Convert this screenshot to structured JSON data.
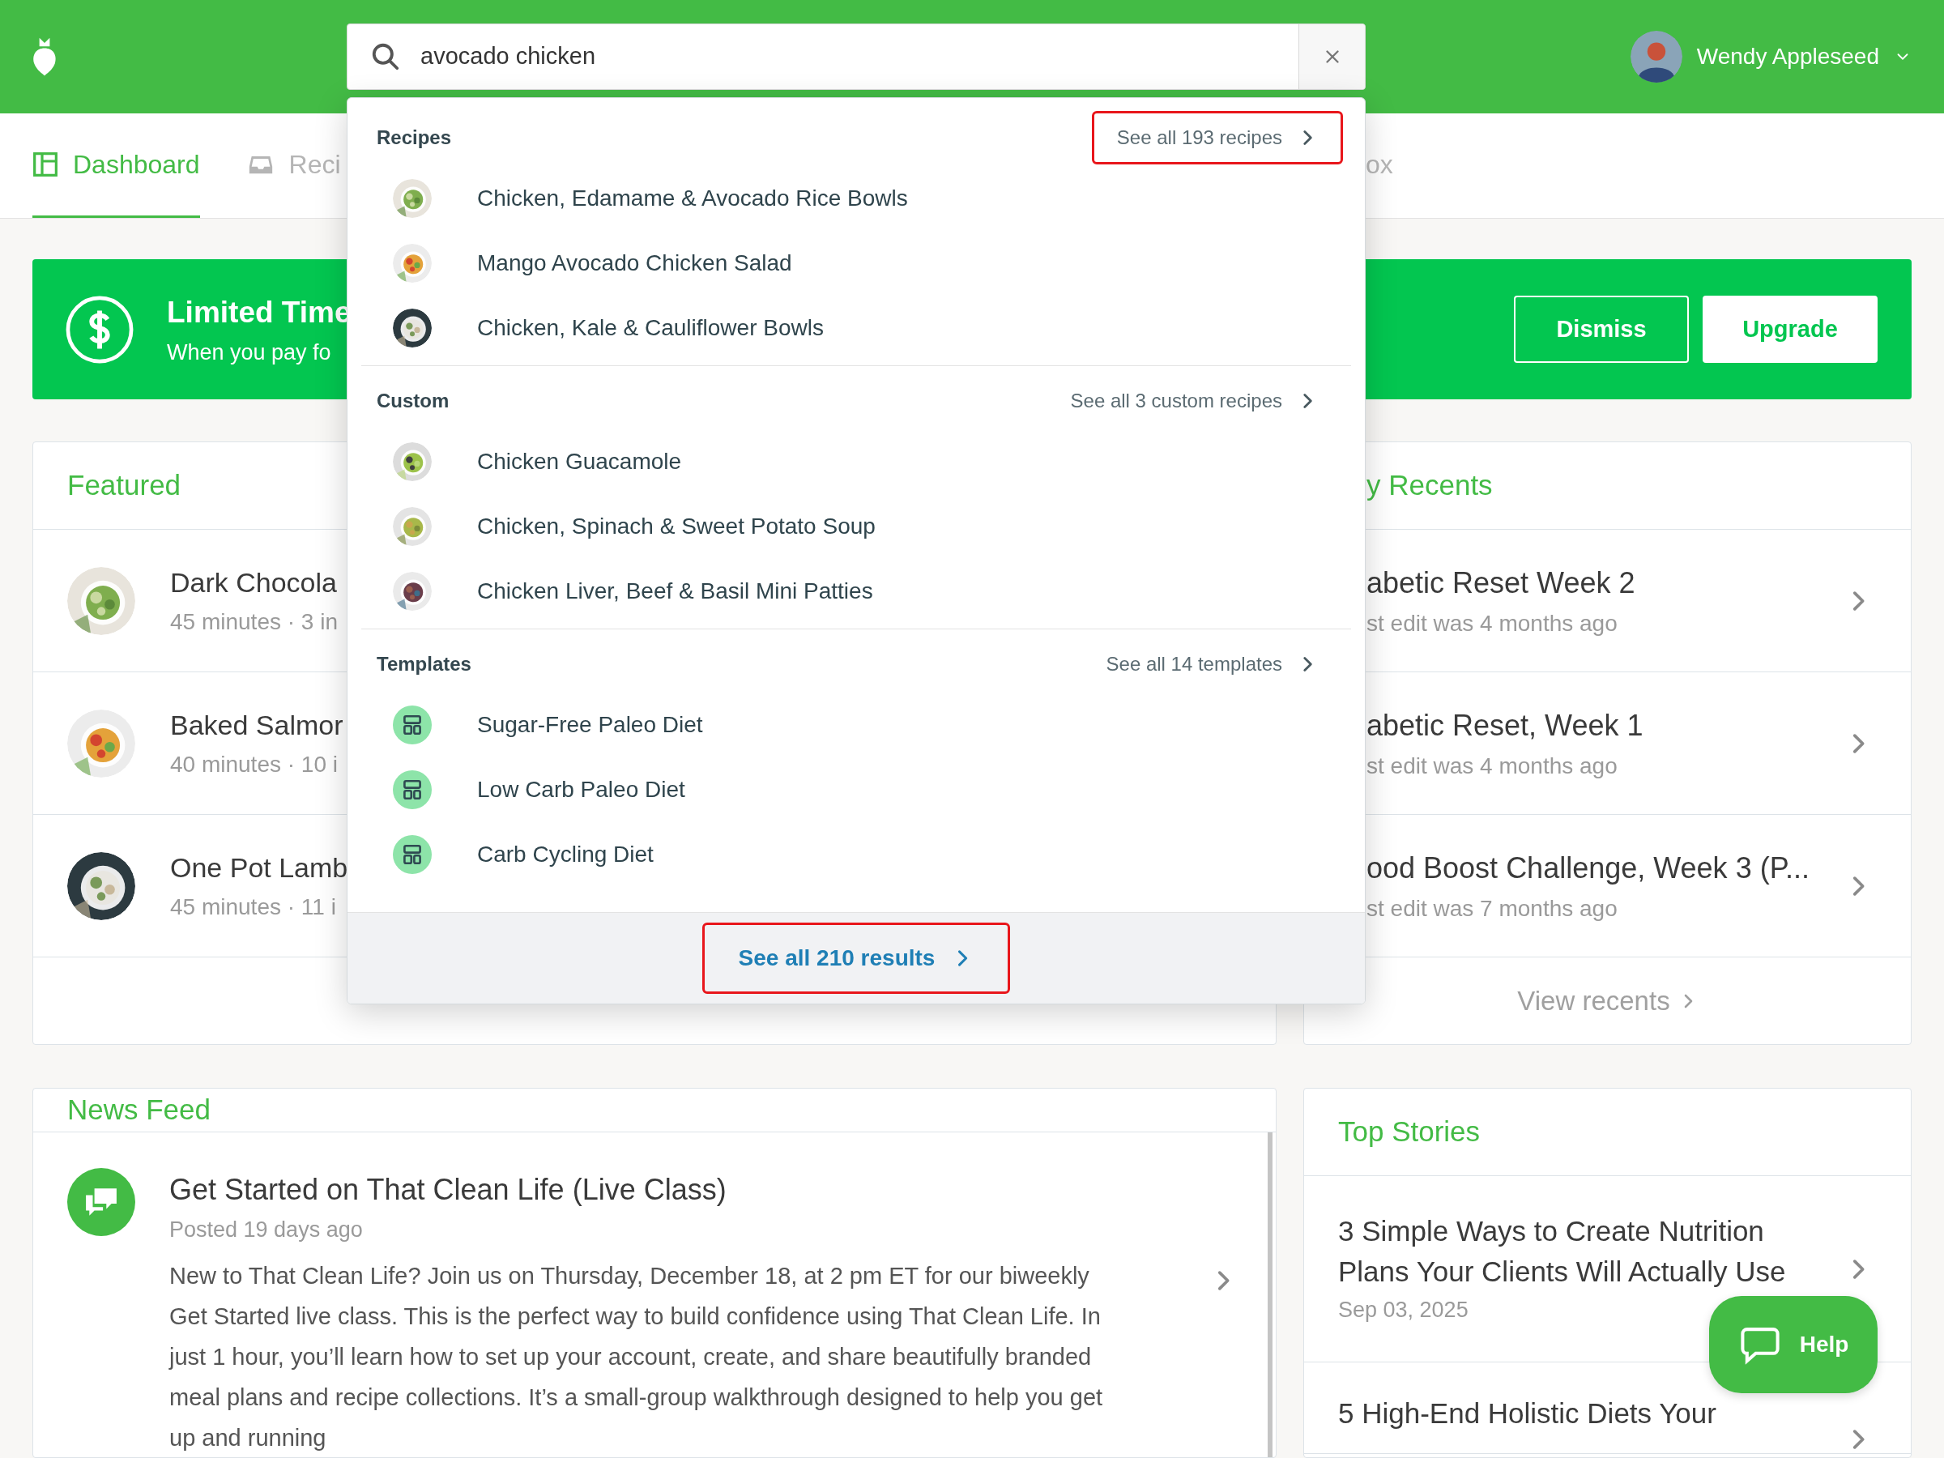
{
  "header": {
    "user_name": "Wendy Appleseed"
  },
  "search": {
    "value": "avocado chicken"
  },
  "nav_tabs": [
    {
      "label": "Dashboard",
      "selected": true,
      "kind": "dashboard"
    },
    {
      "label": "Reci",
      "selected": false,
      "kind": "tray"
    },
    {
      "label": "ox",
      "selected": false,
      "kind": "plain"
    }
  ],
  "banner": {
    "title": "Limited Time",
    "subtitle": "When you pay fo",
    "buttons": [
      {
        "label": "Dismiss",
        "kind": "outline"
      },
      {
        "label": "Upgrade",
        "kind": "solid"
      }
    ]
  },
  "featured": {
    "title": "Featured",
    "items": [
      {
        "title": "Dark Chocola",
        "meta": "45 minutes · 3 in"
      },
      {
        "title": "Baked Salmor",
        "meta": "40 minutes · 10 i"
      },
      {
        "title": "One Pot Lamb",
        "meta": "45 minutes · 11 i"
      }
    ]
  },
  "recents": {
    "title": "y Recents",
    "items": [
      {
        "title": "abetic Reset Week 2",
        "meta": "st edit was 4 months ago"
      },
      {
        "title": "abetic Reset, Week 1",
        "meta": "st edit was 4 months ago"
      },
      {
        "title": "ood Boost Challenge, Week 3 (P...",
        "meta": "st edit was 7 months ago"
      }
    ],
    "link": "View recents"
  },
  "news_feed": {
    "title": "News Feed",
    "items": [
      {
        "title": "Get Started on That Clean Life (Live Class)",
        "posted": "Posted 19 days ago",
        "body": "New to That Clean Life? Join us on Thursday, December 18, at 2 pm ET for our biweekly Get Started live class. This is the perfect way to build confidence using That Clean Life. In just 1 hour, you’ll learn how to set up your account, create, and share beautifully branded meal plans and recipe collections. It’s a small-group walkthrough designed to help you get up and running"
      }
    ]
  },
  "top_stories": {
    "title": "Top Stories",
    "items": [
      {
        "title": "3 Simple Ways to Create Nutrition Plans Your Clients Will Actually Use",
        "date": "Sep 03, 2025"
      },
      {
        "title": "5 High-End Holistic Diets Your"
      }
    ]
  },
  "help_button": {
    "label": "Help"
  },
  "dropdown": {
    "sections": [
      {
        "heading": "Recipes",
        "link": {
          "label": "See all 193 recipes",
          "highlighted": true
        },
        "items": [
          {
            "label": "Chicken, Edamame & Avocado Rice Bowls"
          },
          {
            "label": "Mango Avocado Chicken Salad"
          },
          {
            "label": "Chicken, Kale & Cauliflower Bowls"
          }
        ]
      },
      {
        "heading": "Custom",
        "link": {
          "label": "See all 3 custom recipes",
          "highlighted": false
        },
        "items": [
          {
            "label": "Chicken Guacamole"
          },
          {
            "label": "Chicken, Spinach & Sweet Potato Soup"
          },
          {
            "label": "Chicken Liver, Beef & Basil Mini Patties"
          }
        ]
      },
      {
        "heading": "Templates",
        "link": {
          "label": "See all 14 templates",
          "highlighted": false
        },
        "items": [
          {
            "label": "Sugar-Free Paleo Diet",
            "kind": "template"
          },
          {
            "label": "Low Carb Paleo Diet",
            "kind": "template"
          },
          {
            "label": "Carb Cycling Diet",
            "kind": "template"
          }
        ]
      }
    ],
    "footer_link": {
      "label": "See all 210 results",
      "highlighted": true
    }
  }
}
